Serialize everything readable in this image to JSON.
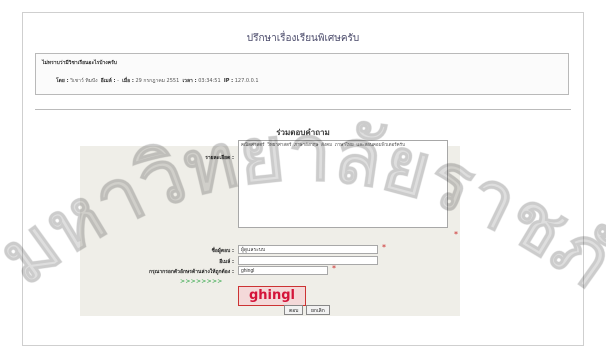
{
  "page_title": "ปรึกษาเรื่องเรียนพิเศษครับ",
  "question": {
    "title": "ไม่ทราบว่ามีวิชาเรียนอะไรบ้างครับ",
    "by_label": "โดย :",
    "author": "วิเชาว์ ทิมปัง",
    "email_label": "อีเมล์ :",
    "email": "-",
    "when_label": "เมื่อ :",
    "date": "29 กรกฎาคม 2551",
    "time_label": "เวลา :",
    "time": "03:34:51",
    "ip_label": "IP :",
    "ip": "127.0.0.1"
  },
  "answer_section": {
    "title": "ร่วมตอบคำถาม",
    "message_label": "รายละเอียด :",
    "message_value": "คณิตศาสตร์ วิทยาศาสตร์ ภาษาอังกฤษ สังคม ภาษาไทย และสอนคอมพิวเตอร์ครับ",
    "name_label": "ชื่อผู้ตอบ :",
    "name_value": "ผู้ดูแลระบบ",
    "email_label": "อีเมล์ :",
    "email_value": "",
    "captcha_label": "กรุณากรอกตัวอักษรด้านล่างให้ถูกต้อง :",
    "captcha_value": "ghingl",
    "captcha_image_text": "ghingl",
    "arrows_text": ">>>>>>>>",
    "required_mark": "*",
    "submit_label": "ตอบ",
    "cancel_label": "ยกเลิก"
  },
  "watermark_text": "มหาวิทยาลัยราชภัฏ"
}
